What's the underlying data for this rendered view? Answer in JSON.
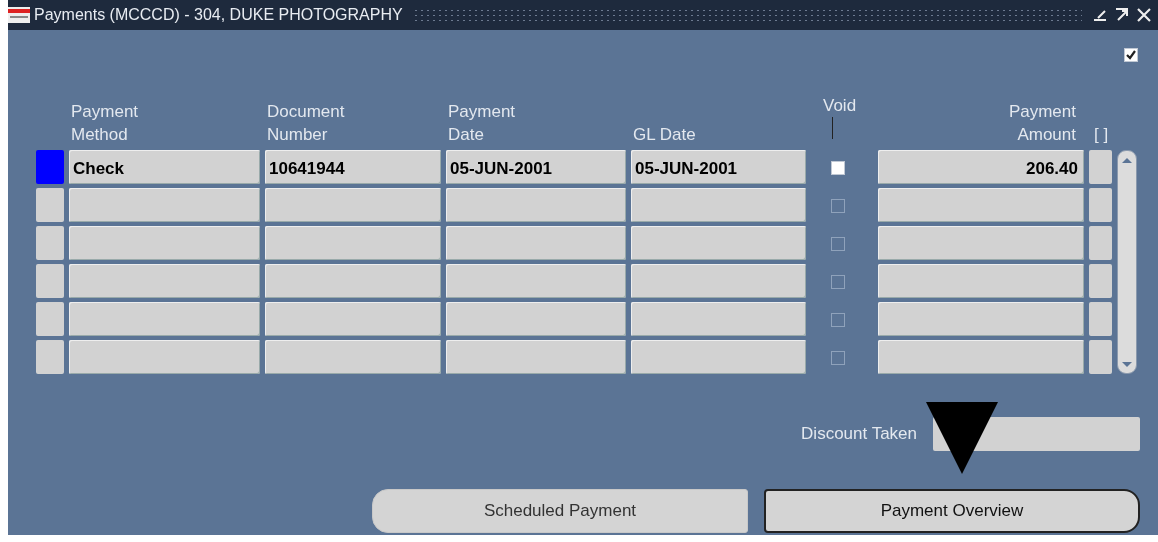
{
  "window": {
    "title": "Payments (MCCCD) - 304, DUKE PHOTOGRAPHY"
  },
  "form_checkbox": {
    "checked": true
  },
  "table": {
    "columns": [
      {
        "kind": "text",
        "lines": [
          "Payment",
          "Method"
        ]
      },
      {
        "kind": "text",
        "lines": [
          "Document",
          "Number"
        ]
      },
      {
        "kind": "text",
        "lines": [
          "Payment",
          "Date"
        ]
      },
      {
        "kind": "text",
        "lines": [
          "GL Date"
        ]
      },
      {
        "kind": "check",
        "lines": [
          "Void"
        ]
      },
      {
        "kind": "amount",
        "lines": [
          "Payment",
          "Amount"
        ]
      },
      {
        "kind": "flex",
        "lines": [
          "[ ]"
        ]
      }
    ],
    "rows": [
      {
        "selected": true,
        "cells": [
          "Check",
          "10641944",
          "05-JUN-2001",
          "05-JUN-2001"
        ],
        "void": {
          "checked": false,
          "disabled": false
        },
        "amount": "206.40"
      },
      {
        "selected": false,
        "cells": [
          "",
          "",
          "",
          ""
        ],
        "void": {
          "checked": false,
          "disabled": true
        },
        "amount": ""
      },
      {
        "selected": false,
        "cells": [
          "",
          "",
          "",
          ""
        ],
        "void": {
          "checked": false,
          "disabled": true
        },
        "amount": ""
      },
      {
        "selected": false,
        "cells": [
          "",
          "",
          "",
          ""
        ],
        "void": {
          "checked": false,
          "disabled": true
        },
        "amount": ""
      },
      {
        "selected": false,
        "cells": [
          "",
          "",
          "",
          ""
        ],
        "void": {
          "checked": false,
          "disabled": true
        },
        "amount": ""
      },
      {
        "selected": false,
        "cells": [
          "",
          "",
          "",
          ""
        ],
        "void": {
          "checked": false,
          "disabled": true
        },
        "amount": ""
      }
    ]
  },
  "discount": {
    "label": "Discount Taken"
  },
  "buttons": [
    {
      "label": "Scheduled Payment",
      "selected": false
    },
    {
      "label": "Payment Overview",
      "selected": true
    }
  ]
}
